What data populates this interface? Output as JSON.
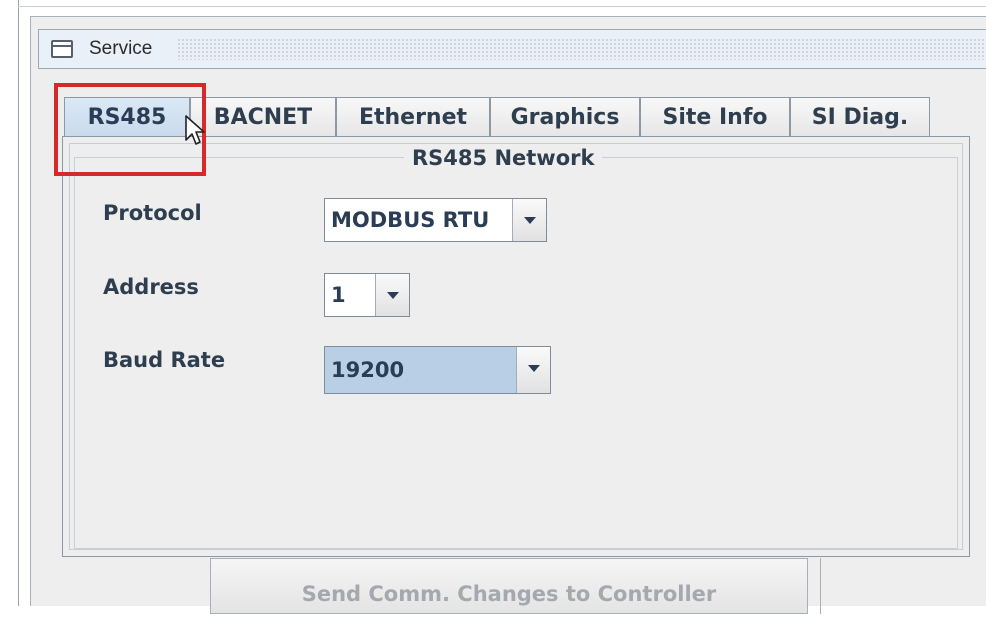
{
  "window": {
    "title": "Service"
  },
  "tabs": [
    {
      "label": "RS485",
      "active": true
    },
    {
      "label": "BACNET",
      "active": false
    },
    {
      "label": "Ethernet",
      "active": false
    },
    {
      "label": "Graphics",
      "active": false
    },
    {
      "label": "Site Info",
      "active": false
    },
    {
      "label": "SI Diag.",
      "active": false
    }
  ],
  "panel": {
    "group_title": "RS485 Network",
    "fields": {
      "protocol": {
        "label": "Protocol",
        "value": "MODBUS RTU"
      },
      "address": {
        "label": "Address",
        "value": "1"
      },
      "baud_rate": {
        "label": "Baud Rate",
        "value": "19200"
      }
    }
  },
  "actions": {
    "send_label": "Send Comm. Changes to Controller"
  },
  "colors": {
    "highlight": "#d42a2a",
    "tab_active": "#c8d9ec"
  }
}
